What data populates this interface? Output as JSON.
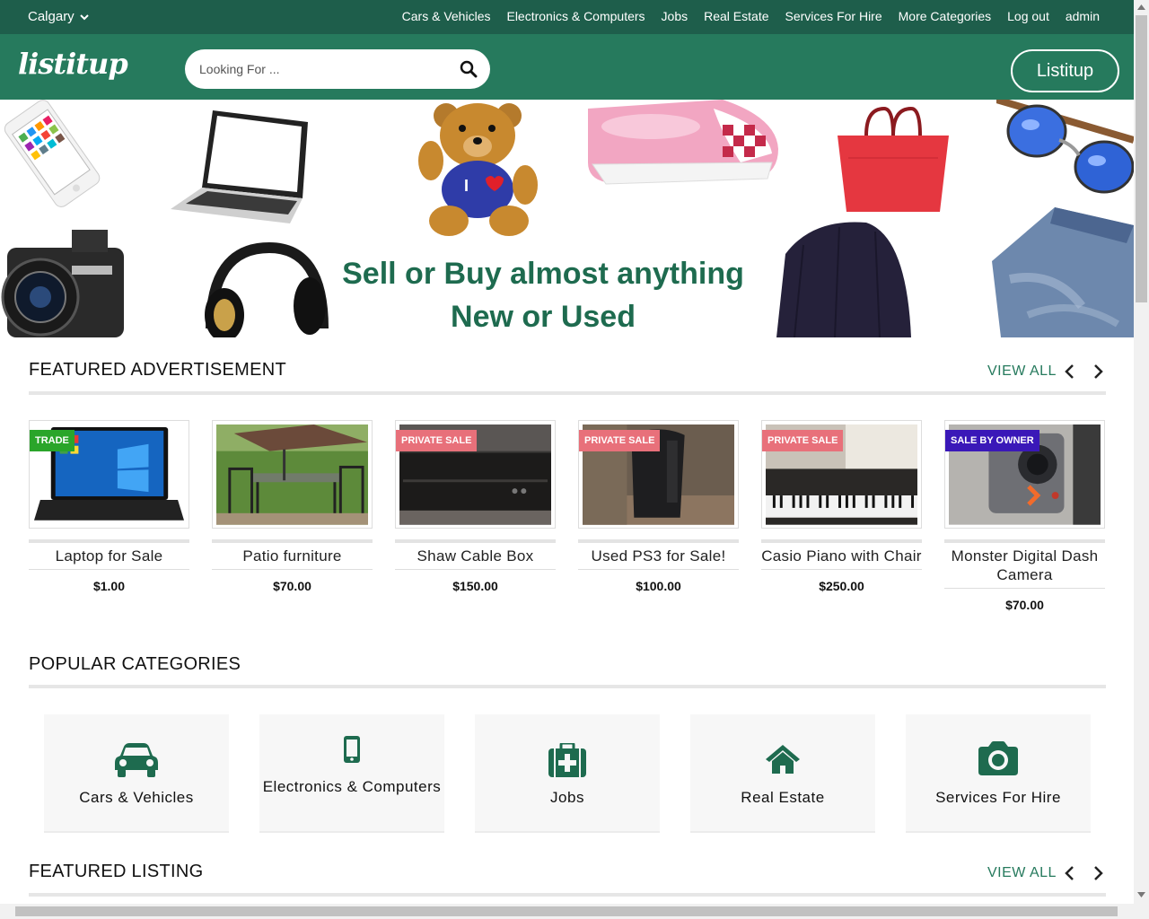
{
  "topbar": {
    "city": "Calgary",
    "nav": [
      "Cars & Vehicles",
      "Electronics & Computers",
      "Jobs",
      "Real Estate",
      "Services For Hire",
      "More Categories",
      "Log out",
      "admin"
    ]
  },
  "header": {
    "logo": "listitup",
    "search_placeholder": "Looking For ...",
    "list_button": "Listitup"
  },
  "hero": {
    "line1": "Sell or Buy almost anything",
    "line2": "New or Used",
    "images": [
      "phone",
      "laptop",
      "teddy-bear",
      "sneakers",
      "handbag",
      "sunglasses",
      "camera",
      "headphones",
      "beanie",
      "jeans"
    ]
  },
  "featured": {
    "title": "FEATURED ADVERTISEMENT",
    "view_all": "VIEW ALL",
    "items": [
      {
        "title": "Laptop for Sale",
        "price": "$1.00",
        "badge": "TRADE",
        "badge_color": "#2aa52a"
      },
      {
        "title": "Patio furniture",
        "price": "$70.00",
        "badge": "",
        "badge_color": ""
      },
      {
        "title": "Shaw Cable Box",
        "price": "$150.00",
        "badge": "PRIVATE SALE",
        "badge_color": "#e8707a"
      },
      {
        "title": "Used PS3 for Sale!",
        "price": "$100.00",
        "badge": "PRIVATE SALE",
        "badge_color": "#e8707a"
      },
      {
        "title": "Casio Piano with Chair",
        "price": "$250.00",
        "badge": "PRIVATE SALE",
        "badge_color": "#e8707a"
      },
      {
        "title": "Monster Digital Dash Camera",
        "price": "$70.00",
        "badge": "SALE BY OWNER",
        "badge_color": "#3a18b8"
      }
    ]
  },
  "popular": {
    "title": "POPULAR CATEGORIES",
    "categories": [
      {
        "label": "Cars & Vehicles",
        "icon": "car-icon"
      },
      {
        "label": "Electronics & Computers",
        "icon": "mobile-phone-icon"
      },
      {
        "label": "Jobs",
        "icon": "first-aid-kit-icon"
      },
      {
        "label": "Real Estate",
        "icon": "home-icon"
      },
      {
        "label": "Services For Hire",
        "icon": "camera-icon"
      }
    ]
  },
  "featured_listing": {
    "title": "FEATURED LISTING",
    "view_all": "VIEW ALL"
  },
  "colors": {
    "topbar": "#1e5e4b",
    "header": "#267a5d",
    "accent": "#1e6b4f"
  }
}
